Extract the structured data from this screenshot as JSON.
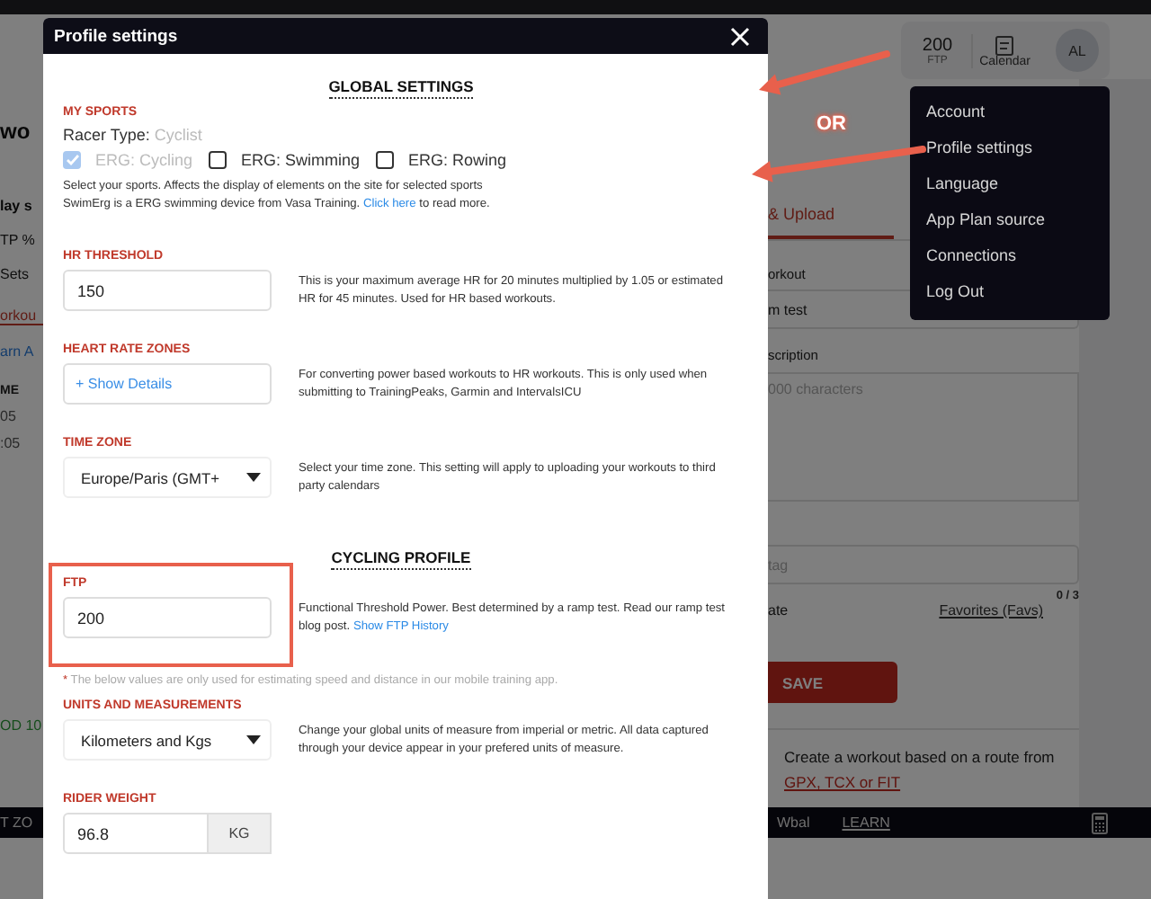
{
  "page": {
    "left_fragments": [
      {
        "text": "wo",
        "kind": "title"
      },
      {
        "text": "lay s",
        "kind": "heading"
      },
      {
        "text": "TP %",
        "kind": "text"
      },
      {
        "text": "Sets",
        "kind": "text"
      },
      {
        "text": "orkou",
        "kind": "tab"
      },
      {
        "text": "arn A",
        "kind": "link"
      },
      {
        "text": "ME",
        "kind": "column"
      },
      {
        "text": "05",
        "kind": "cell"
      },
      {
        "text": ":05",
        "kind": "cell"
      },
      {
        "text": "OD 10",
        "kind": "success"
      }
    ],
    "header": {
      "ftp_value": "200",
      "ftp_label": "FTP",
      "calendar": "Calendar",
      "avatar": "AL"
    },
    "tab": "& Upload",
    "name_label": "orkout",
    "name_value": "m test",
    "description_label": "scription",
    "description_placeholder": "000 characters",
    "tag_placeholder": "tag",
    "tag_count": "0 / 3",
    "private_label": "ate",
    "favorites_link": "Favorites (Favs)",
    "save_button": "SAVE",
    "route_text": "Create a workout based on a route from ",
    "route_link": "GPX, TCX or FIT",
    "bottom_bar": {
      "left_fragment": "T ZO",
      "items": [
        {
          "label": "Wbal",
          "kind": "text"
        },
        {
          "label": "LEARN",
          "kind": "link"
        }
      ]
    }
  },
  "menu": {
    "items": [
      "Account",
      "Profile settings",
      "Language",
      "App Plan source",
      "Connections",
      "Log Out"
    ]
  },
  "modal": {
    "title": "Profile settings",
    "global_heading": "GLOBAL SETTINGS",
    "my_sports": {
      "label": "MY SPORTS",
      "racer_type_label": "Racer Type:",
      "racer_type_value": "Cyclist",
      "sports": [
        {
          "label": "ERG: Cycling",
          "checked": true,
          "disabled": true
        },
        {
          "label": "ERG: Swimming",
          "checked": false,
          "disabled": false
        },
        {
          "label": "ERG: Rowing",
          "checked": false,
          "disabled": false
        }
      ],
      "description_1": "Select your sports. Affects the display of elements on the site for selected sports",
      "description_2": "SwimErg is a ERG swimming device from Vasa Training. ",
      "link": "Click here",
      "description_2_tail": " to read more."
    },
    "settings": [
      {
        "label": "HR THRESHOLD",
        "kind": "input",
        "value": "150",
        "description": "This is your maximum average HR for 20 minutes multiplied by 1.05 or estimated HR for 45 minutes. Used for HR based workouts."
      },
      {
        "label": "HEART RATE ZONES",
        "kind": "details",
        "value": "+ Show Details",
        "description": "For converting power based workouts to HR workouts. This is only used when submitting to TrainingPeaks, Garmin and IntervalsICU"
      },
      {
        "label": "TIME ZONE",
        "kind": "select",
        "value": "Europe/Paris (GMT+",
        "description": "Select your time zone. This setting will apply to uploading your workouts to third party calendars"
      }
    ],
    "cycling_heading": "CYCLING PROFILE",
    "ftp": {
      "label": "FTP",
      "value": "200",
      "description": "Functional Threshold Power. Best determined by a ramp test. Read our ramp test blog post. ",
      "link": "Show FTP History"
    },
    "note": {
      "mark": "*",
      "text": " The below values are only used for estimating speed and distance in our mobile training app."
    },
    "cycling_settings": [
      {
        "label": "UNITS AND MEASUREMENTS",
        "kind": "select",
        "value": "Kilometers and Kgs",
        "description": "Change your global units of measure from imperial or metric. All data captured through your device appear in your prefered units of measure."
      },
      {
        "label": "RIDER WEIGHT",
        "kind": "unit_input",
        "value": "96.8",
        "unit": "KG"
      }
    ]
  },
  "annotations": {
    "or_label": "OR"
  }
}
